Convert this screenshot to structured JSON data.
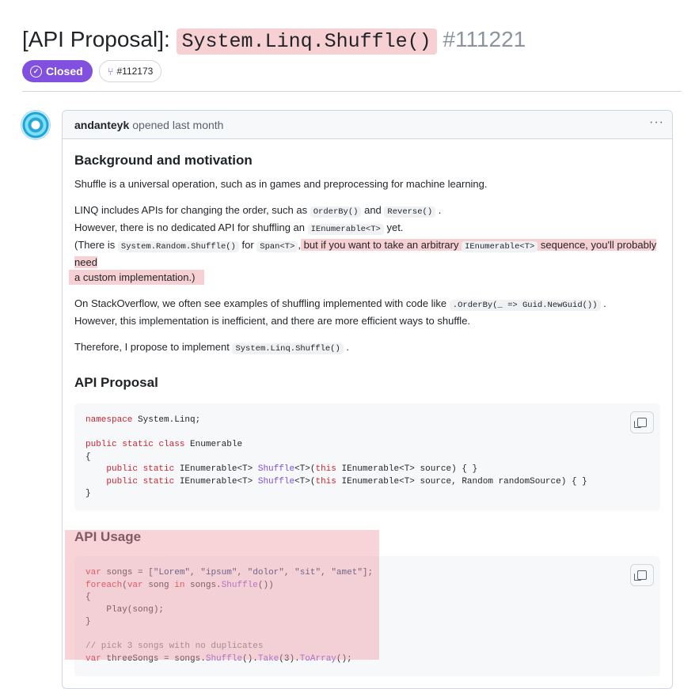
{
  "issue": {
    "title_prefix": "[API Proposal]:",
    "title_code": "System.Linq.Shuffle()",
    "number": "#111221",
    "state": "Closed",
    "linked_pr": "#112173"
  },
  "comment": {
    "author": "andanteyk",
    "meta": "opened last month",
    "more_label": "···"
  },
  "sections": {
    "background_heading": "Background and motivation",
    "p1": "Shuffle is a universal operation, such as in games and preprocessing for machine learning.",
    "p2_a": "LINQ includes APIs for changing the order, such as",
    "p2_code1": "OrderBy()",
    "p2_b": "and",
    "p2_code2": "Reverse()",
    "p2_c": ".",
    "p3_a": "However, there is no dedicated API for shuffling an",
    "p3_code": "IEnumerable<T>",
    "p3_b": "yet.",
    "p4_a": "(There is",
    "p4_code1": "System.Random.Shuffle()",
    "p4_b": "for",
    "p4_code2": "Span<T>",
    "p4_c": ",",
    "p4_d": " but if you want to take an arbitrary",
    "p4_code3": "IEnumerable<T>",
    "p4_e": "sequence, you'll probably need",
    "p4_f": "a custom implementation.)",
    "p5_a": "On StackOverflow, we often see examples of shuffling implemented with code like",
    "p5_code": ".OrderBy(_ => Guid.NewGuid())",
    "p5_b": ".",
    "p6": "However, this implementation is inefficient, and there are more efficient ways to shuffle.",
    "p7_a": "Therefore, I propose to implement",
    "p7_code": "System.Linq.Shuffle()",
    "p7_b": ".",
    "proposal_heading": "API Proposal",
    "usage_heading": "API Usage"
  },
  "code_proposal": {
    "l1_kw": "namespace",
    "l1_rest": " System.Linq;",
    "l3_kw1": "public",
    "l3_kw2": "static",
    "l3_kw3": "class",
    "l3_rest": " Enumerable",
    "l4": "{",
    "l5_kw1": "public",
    "l5_kw2": "static",
    "l5_a": " IEnumerable<T> ",
    "l5_fn": "Shuffle",
    "l5_b": "<T>(",
    "l5_kw3": "this",
    "l5_c": " IEnumerable<T> source) { }",
    "l6_kw1": "public",
    "l6_kw2": "static",
    "l6_a": " IEnumerable<T> ",
    "l6_fn": "Shuffle",
    "l6_b": "<T>(",
    "l6_kw3": "this",
    "l6_c": " IEnumerable<T> source, Random randomSource) { }",
    "l7": "}"
  },
  "code_usage": {
    "l1_kw": "var",
    "l1_a": " songs = [",
    "l1_s1": "\"Lorem\"",
    "l1_s2": "\"ipsum\"",
    "l1_s3": "\"dolor\"",
    "l1_s4": "\"sit\"",
    "l1_s5": "\"amet\"",
    "l1_b": "];",
    "l2_kw1": "foreach",
    "l2_a": "(",
    "l2_kw2": "var",
    "l2_b": " song ",
    "l2_kw3": "in",
    "l2_c": " songs.",
    "l2_fn": "Shuffle",
    "l2_d": "())",
    "l3": "{",
    "l4": "    Play(song);",
    "l5": "}",
    "l7": "// pick 3 songs with no duplicates",
    "l8_kw": "var",
    "l8_a": " threeSongs = songs.",
    "l8_fn1": "Shuffle",
    "l8_b": "().",
    "l8_fn2": "Take",
    "l8_c": "(3).",
    "l8_fn3": "ToArray",
    "l8_d": "();"
  },
  "colors": {
    "closed_badge": "#8250df",
    "highlight": "#f7d0d3",
    "keyword": "#cf222e",
    "function": "#8250df"
  },
  "icons": {
    "closed": "check-circle-icon",
    "pr": "git-merge-icon",
    "copy": "copy-icon"
  }
}
